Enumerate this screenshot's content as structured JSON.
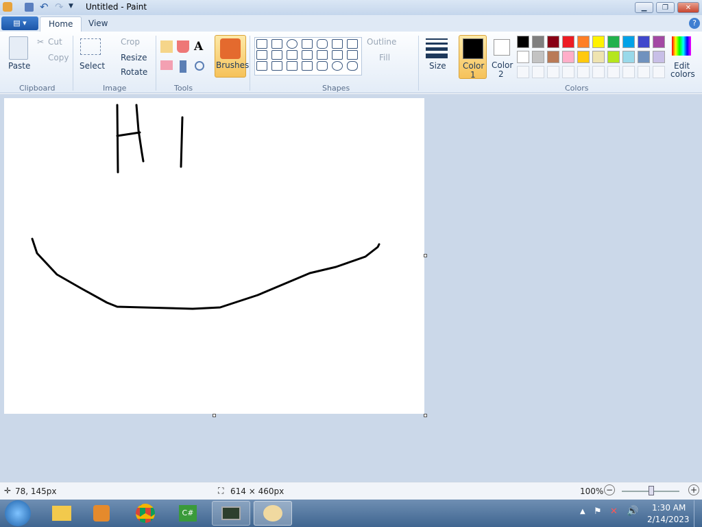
{
  "title": "Untitled - Paint",
  "tabs": {
    "home": "Home",
    "view": "View"
  },
  "clip": {
    "paste": "Paste",
    "cut": "Cut",
    "copy": "Copy",
    "label": "Clipboard"
  },
  "image": {
    "select": "Select",
    "crop": "Crop",
    "resize": "Resize",
    "rotate": "Rotate",
    "label": "Image"
  },
  "tools": {
    "label": "Tools",
    "text": "A"
  },
  "brushes": "Brushes",
  "shapes": {
    "label": "Shapes",
    "outline": "Outline",
    "fill": "Fill"
  },
  "size": "Size",
  "color1": {
    "a": "Color",
    "b": "1"
  },
  "color2": {
    "a": "Color",
    "b": "2"
  },
  "colors": {
    "label": "Colors",
    "edit_a": "Edit",
    "edit_b": "colors",
    "row1": [
      "#000000",
      "#7f7f7f",
      "#880015",
      "#ed1c24",
      "#ff7f27",
      "#fff200",
      "#22b14c",
      "#00a2e8",
      "#3f48cc",
      "#a349a4"
    ],
    "row2": [
      "#ffffff",
      "#c3c3c3",
      "#b97a57",
      "#ffaec9",
      "#ffc90e",
      "#efe4b0",
      "#b5e61d",
      "#99d9ea",
      "#7092be",
      "#c8bfe7"
    ]
  },
  "status": {
    "cursor": "78, 145px",
    "size": "614 × 460px",
    "zoom": "100%"
  },
  "clock": {
    "time": "1:30 AM",
    "date": "2/14/2023"
  }
}
